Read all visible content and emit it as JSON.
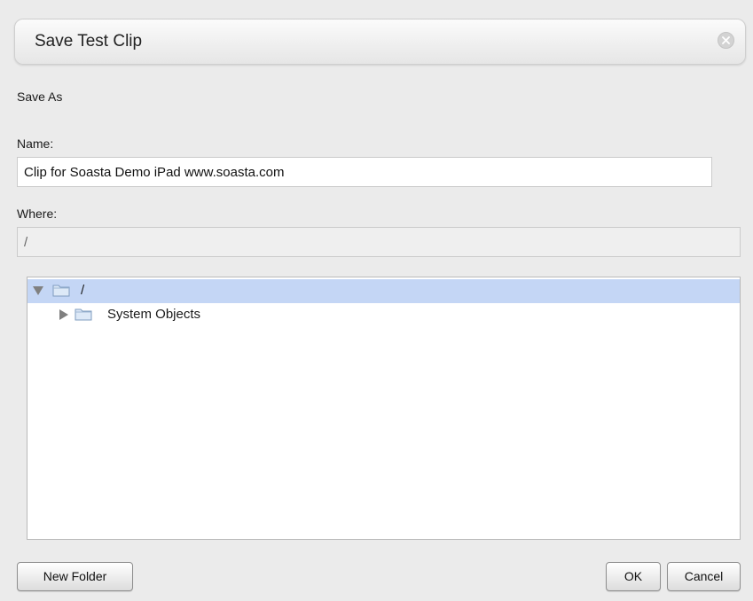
{
  "dialog": {
    "title": "Save Test Clip",
    "section_heading": "Save As",
    "name_label": "Name:",
    "name_value": "Clip for Soasta Demo iPad www.soasta.com",
    "where_label": "Where:",
    "where_value": "/",
    "tree": [
      {
        "label": "/",
        "expanded": true,
        "selected": true,
        "level": 0
      },
      {
        "label": "System Objects",
        "expanded": false,
        "selected": false,
        "level": 1
      }
    ],
    "buttons": {
      "new_folder": "New Folder",
      "ok": "OK",
      "cancel": "Cancel"
    }
  },
  "colors": {
    "selection": "#c4d6f5",
    "background": "#ebebeb",
    "folder": "#bcd3ee"
  }
}
